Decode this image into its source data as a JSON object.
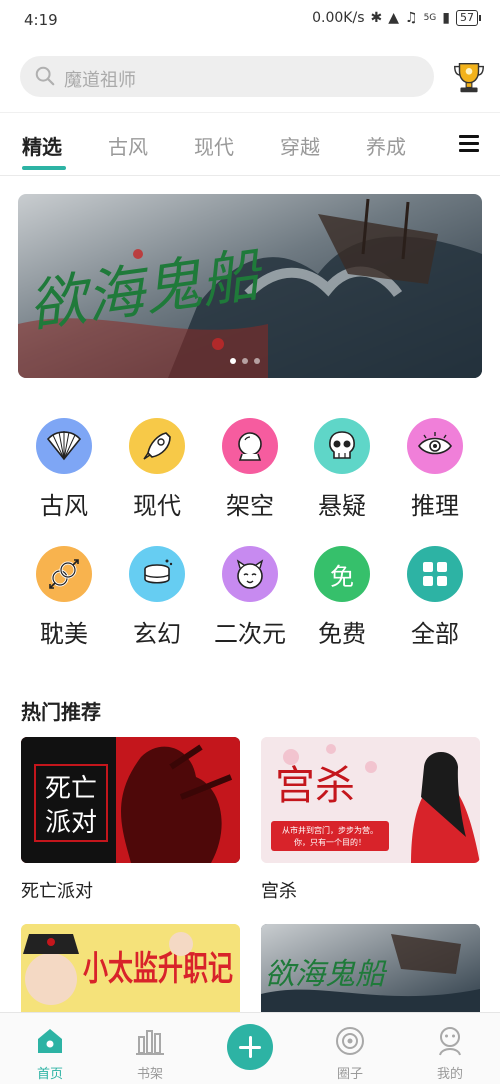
{
  "status_bar": {
    "time": "4:19",
    "speed": "0.00K/s",
    "network": "5G",
    "battery": "57"
  },
  "search": {
    "placeholder": "魔道祖师"
  },
  "tabs": [
    "精选",
    "古风",
    "现代",
    "穿越",
    "养成"
  ],
  "banner": {
    "title_art": "欲海鬼船",
    "slides": 3,
    "active_slide": 1
  },
  "categories": [
    {
      "label": "古风",
      "icon": "fan-icon",
      "color": "#7ea6f5"
    },
    {
      "label": "现代",
      "icon": "rocket-icon",
      "color": "#f7c948"
    },
    {
      "label": "架空",
      "icon": "crystal-ball-icon",
      "color": "#f65c9f"
    },
    {
      "label": "悬疑",
      "icon": "skull-icon",
      "color": "#5fd6c8"
    },
    {
      "label": "推理",
      "icon": "eye-icon",
      "color": "#f07fd9"
    },
    {
      "label": "耽美",
      "icon": "gender-icon",
      "color": "#f8b34e"
    },
    {
      "label": "玄幻",
      "icon": "magic-hat-icon",
      "color": "#66cdf2"
    },
    {
      "label": "二次元",
      "icon": "anime-face-icon",
      "color": "#c78af0"
    },
    {
      "label": "免费",
      "icon": "free-icon",
      "icon_text": "免",
      "color": "#36c06b"
    },
    {
      "label": "全部",
      "icon": "grid-icon",
      "color": "#2db3a4"
    }
  ],
  "hot_section": {
    "title": "热门推荐"
  },
  "books": [
    {
      "title": "死亡派对",
      "cover_text": "死亡\n派对"
    },
    {
      "title": "宫杀",
      "cover_text": "宫杀",
      "cover_sub": "从市井到宫门，步步为营。\n你，只有一个目的！"
    },
    {
      "cover_text": "小太监升职记"
    },
    {
      "cover_text": "欲海鬼船"
    }
  ],
  "bottom_nav": [
    {
      "label": "首页",
      "icon": "home-icon",
      "active": true
    },
    {
      "label": "书架",
      "icon": "bookshelf-icon",
      "active": false
    },
    {
      "label": "",
      "icon": "plus-icon",
      "active": false
    },
    {
      "label": "圈子",
      "icon": "circle-target-icon",
      "active": false
    },
    {
      "label": "我的",
      "icon": "profile-icon",
      "active": false
    }
  ],
  "colors": {
    "accent": "#2db3a4",
    "tab_inactive": "#9a9a9a",
    "search_bg": "#eeeeee"
  }
}
